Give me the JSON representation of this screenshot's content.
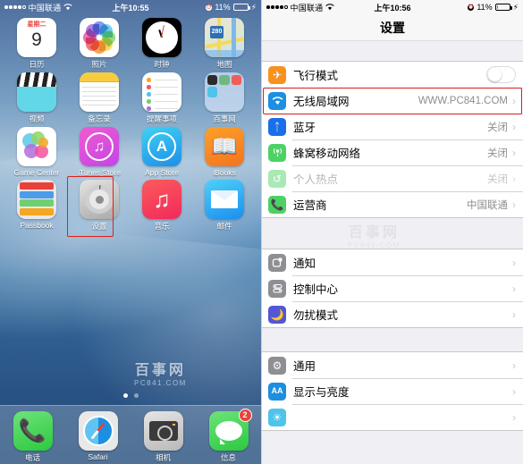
{
  "home": {
    "status": {
      "signal_dots": 5,
      "signal_filled": 4,
      "carrier": "中国联通",
      "wifi_icon": "wifi-icon",
      "time": "上午10:55",
      "battery_percent": "11%",
      "battery_level": 11,
      "lock_icon": "alarm-icon",
      "charging_icon": "charging-icon"
    },
    "rows": [
      [
        {
          "name": "calendar",
          "label": "日历",
          "weekday": "星期二",
          "day": "9"
        },
        {
          "name": "photos",
          "label": "照片"
        },
        {
          "name": "clock",
          "label": "时钟"
        },
        {
          "name": "maps",
          "label": "地图",
          "shield": "280"
        }
      ],
      [
        {
          "name": "videos",
          "label": "视频"
        },
        {
          "name": "notes",
          "label": "备忘录"
        },
        {
          "name": "reminders",
          "label": "提醒事项"
        },
        {
          "name": "folder",
          "label": "百事网"
        }
      ],
      [
        {
          "name": "game-center",
          "label": "Game Center"
        },
        {
          "name": "itunes-store",
          "label": "iTunes Store"
        },
        {
          "name": "app-store",
          "label": "App Store"
        },
        {
          "name": "ibooks",
          "label": "iBooks"
        }
      ],
      [
        {
          "name": "passbook",
          "label": "Passbook"
        },
        {
          "name": "settings",
          "label": "设置",
          "selected": true
        },
        {
          "name": "music",
          "label": "音乐"
        },
        {
          "name": "mail",
          "label": "邮件"
        }
      ]
    ],
    "dock": [
      {
        "name": "phone",
        "label": "电话"
      },
      {
        "name": "safari",
        "label": "Safari"
      },
      {
        "name": "camera",
        "label": "相机"
      },
      {
        "name": "messages",
        "label": "信息",
        "badge": "2"
      }
    ],
    "page_dots": {
      "count": 2,
      "active": 1
    },
    "watermark": {
      "line1": "百事网",
      "line2": "PC841.COM"
    }
  },
  "settings": {
    "status": {
      "carrier": "中国联通",
      "time": "上午10:56",
      "battery_percent": "11%",
      "battery_level": 11
    },
    "title": "设置",
    "watermark": {
      "line1": "百事网",
      "line2": "PC841.COM"
    },
    "groups": [
      {
        "rows": [
          {
            "name": "airplane-mode",
            "icon": "airplane-icon",
            "icon_color": "#f7921e",
            "label": "飞行模式",
            "control": "toggle",
            "toggle_on": false
          },
          {
            "name": "wifi",
            "icon": "wifi-icon",
            "icon_color": "#1c8fe0",
            "label": "无线局域网",
            "value": "WWW.PC841.COM",
            "control": "chevron",
            "highlight": true
          },
          {
            "name": "bluetooth",
            "icon": "bluetooth-icon",
            "icon_color": "#1a6ee8",
            "label": "蓝牙",
            "value": "关闭",
            "control": "chevron"
          },
          {
            "name": "cellular",
            "icon": "cellular-icon",
            "icon_color": "#4cd264",
            "label": "蜂窝移动网络",
            "value": "关闭",
            "control": "chevron"
          },
          {
            "name": "personal-hotspot",
            "icon": "hotspot-icon",
            "icon_color": "#a8e9b4",
            "label": "个人热点",
            "value": "关闭",
            "control": "chevron",
            "dim": true
          },
          {
            "name": "carrier",
            "icon": "phone-icon",
            "icon_color": "#4cd264",
            "label": "运营商",
            "value": "中国联通",
            "control": "chevron"
          }
        ]
      },
      {
        "rows": [
          {
            "name": "notifications",
            "icon": "notification-icon",
            "icon_color": "#8e8e93",
            "label": "通知",
            "control": "chevron"
          },
          {
            "name": "control-center",
            "icon": "control-center-icon",
            "icon_color": "#8e8e93",
            "label": "控制中心",
            "control": "chevron"
          },
          {
            "name": "do-not-disturb",
            "icon": "moon-icon",
            "icon_color": "#5456d6",
            "label": "勿扰模式",
            "control": "chevron"
          }
        ]
      },
      {
        "rows": [
          {
            "name": "general",
            "icon": "gear-icon",
            "icon_color": "#8e8e93",
            "label": "通用",
            "control": "chevron"
          },
          {
            "name": "display-brightness",
            "icon": "aa-icon",
            "icon_color": "#1c8fe0",
            "label": "显示与亮度",
            "control": "chevron"
          },
          {
            "name": "wallpaper",
            "icon": "wallpaper-icon",
            "icon_color": "#4fc3ea",
            "label": "",
            "control": "chevron"
          }
        ]
      }
    ]
  }
}
